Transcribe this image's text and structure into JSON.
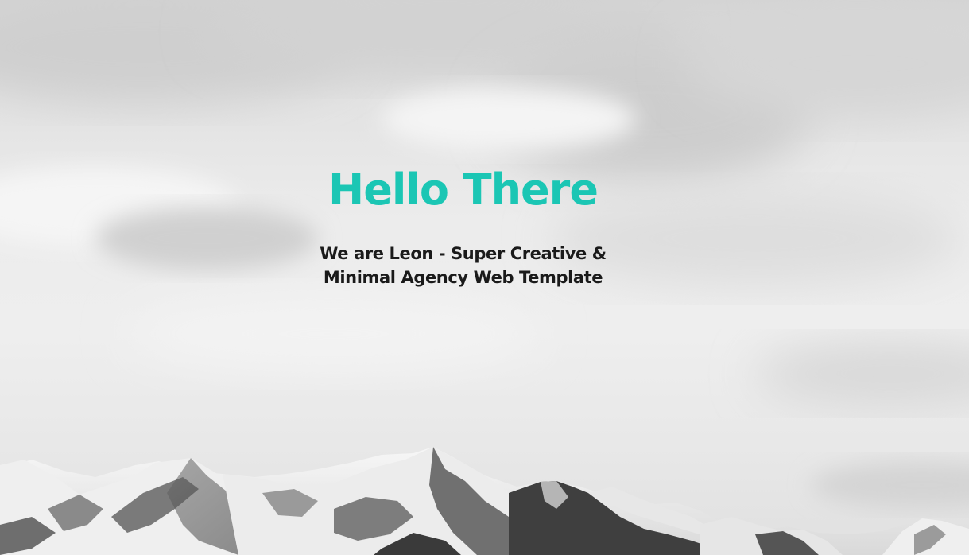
{
  "hero": {
    "title": "Hello There",
    "subtitle": "We are Leon - Super Creative & Minimal Agency Web Template"
  },
  "colors": {
    "accent": "#1bc6b4",
    "subtitle_text": "#1a1a1a",
    "sky": "#e6e6e6",
    "snow": "#f4f4f4",
    "rock": "#4a4a4a"
  },
  "background": {
    "image": "mountain-sky-photo"
  }
}
